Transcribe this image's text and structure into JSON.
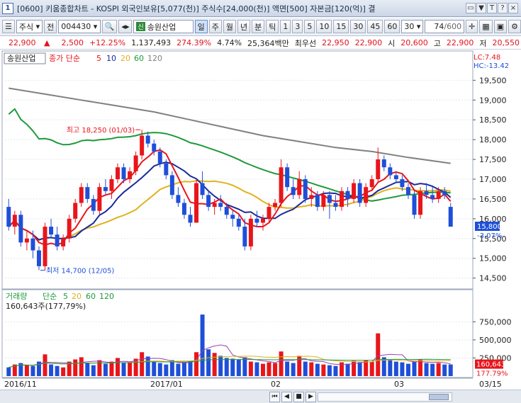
{
  "window": {
    "number": "1",
    "title": "[0600] 키움종합차트 - KOSPI 외국인보유[5,077(천)] 주식수[24,000(천)] 액면[500] 자본금[120(억)] 결",
    "buttons": [
      "▭",
      "▼",
      "T",
      "?",
      "×"
    ]
  },
  "toolbar": {
    "market": "주식",
    "jeon": "전",
    "code": "004430",
    "stock_badge": "신",
    "stock_name": "송원산업",
    "period_buttons": [
      "일",
      "주",
      "월",
      "년",
      "분",
      "틱"
    ],
    "active_period": "일",
    "interval_buttons": [
      "1",
      "3",
      "5",
      "10",
      "15",
      "30",
      "45",
      "60"
    ],
    "interval_value": "30",
    "count": "74",
    "count_total": "/600"
  },
  "infobar": {
    "price": "22,900",
    "change_arrow": "▲",
    "change": "2,500",
    "change_pct": "+12.25%",
    "volume": "1,137,493",
    "vol_ratio": "274.39%",
    "turnover": "4.74%",
    "amount": "25,364백만",
    "best_label": "최우선",
    "best_ask": "22,950",
    "best_bid": "22,900",
    "open_label": "시",
    "open": "20,600",
    "high_label": "고",
    "high": "22,900",
    "low_label": "저",
    "low": "20,550"
  },
  "price_panel": {
    "stock_tag": "송원산업",
    "legend": [
      "종가 단순",
      "5",
      "10",
      "20",
      "60",
      "120"
    ],
    "lc": "LC:7.48",
    "hc": "HC:-13.42",
    "max_label": "최고 18,250 (01/03)",
    "min_label": "최저 14,700 (12/05)",
    "last_label": "15,800",
    "last_pct": "-3.07%"
  },
  "volume_panel": {
    "legend": [
      "거래량",
      "단순",
      "5",
      "20",
      "60",
      "120"
    ],
    "info": "160,643주(177,79%)",
    "last_label": "160,643",
    "last_pct": "177.79%"
  },
  "date_axis": [
    "2016/11",
    "2017/01",
    "02",
    "03",
    "03/15"
  ],
  "colors": {
    "up": "#e8151b",
    "down": "#1f4fd8",
    "ma5": "#e8151b",
    "ma10": "#1a2a9a",
    "ma20": "#e0b21e",
    "ma60": "#1f9a3a",
    "ma120": "#808080"
  },
  "chart_data": {
    "type": "candlestick",
    "price_axis_ticks": [
      14500,
      15000,
      15500,
      16000,
      16500,
      17000,
      17500,
      18000,
      18500,
      19000,
      19500
    ],
    "price_axis_labels": [
      "14,500",
      "15,000",
      "15,500",
      "16,000",
      "16,500",
      "17,000",
      "17,500",
      "18,000",
      "18,500",
      "19,000",
      "19,500"
    ],
    "ylim": [
      14350,
      19900
    ],
    "volume_axis_ticks": [
      250000,
      500000,
      750000
    ],
    "volume_axis_labels": [
      "250,000",
      "500,000",
      "750,000"
    ],
    "volume_ylim": [
      0,
      900000
    ],
    "candles": [
      [
        16300,
        16500,
        15700,
        15800,
        120000
      ],
      [
        15800,
        16200,
        15600,
        16100,
        160000
      ],
      [
        16100,
        16200,
        15300,
        15400,
        180000
      ],
      [
        15400,
        15700,
        15200,
        15500,
        150000
      ],
      [
        15500,
        15700,
        15000,
        15200,
        140000
      ],
      [
        15200,
        15300,
        14700,
        14800,
        200000
      ],
      [
        14800,
        15900,
        14700,
        15800,
        300000
      ],
      [
        15800,
        16000,
        15500,
        15600,
        160000
      ],
      [
        15600,
        15800,
        15200,
        15300,
        140000
      ],
      [
        15300,
        15600,
        15200,
        15500,
        120000
      ],
      [
        15500,
        16100,
        15400,
        16000,
        200000
      ],
      [
        16000,
        16500,
        15900,
        16400,
        230000
      ],
      [
        16400,
        16900,
        16300,
        16800,
        260000
      ],
      [
        16800,
        16900,
        16400,
        16500,
        180000
      ],
      [
        16500,
        16600,
        16100,
        16200,
        150000
      ],
      [
        16200,
        16900,
        16100,
        16800,
        220000
      ],
      [
        16800,
        17000,
        16600,
        16700,
        170000
      ],
      [
        16700,
        17100,
        16500,
        17000,
        200000
      ],
      [
        17000,
        17400,
        16900,
        17300,
        250000
      ],
      [
        17300,
        17400,
        16900,
        17000,
        180000
      ],
      [
        17000,
        17300,
        16900,
        17200,
        190000
      ],
      [
        17200,
        17700,
        17100,
        17600,
        240000
      ],
      [
        17600,
        18250,
        17500,
        18100,
        330000
      ],
      [
        18100,
        18200,
        17800,
        17900,
        270000
      ],
      [
        17900,
        18000,
        17600,
        17700,
        200000
      ],
      [
        17700,
        17800,
        17300,
        17400,
        180000
      ],
      [
        17400,
        17500,
        17000,
        17100,
        160000
      ],
      [
        17100,
        17200,
        16500,
        16600,
        220000
      ],
      [
        16600,
        16800,
        16300,
        16400,
        170000
      ],
      [
        16400,
        16500,
        16000,
        16100,
        190000
      ],
      [
        16100,
        16300,
        15800,
        15900,
        210000
      ],
      [
        15900,
        17000,
        15900,
        16900,
        330000
      ],
      [
        16900,
        17200,
        16500,
        16600,
        850000
      ],
      [
        16600,
        16700,
        16200,
        16300,
        370000
      ],
      [
        16300,
        16500,
        16100,
        16400,
        320000
      ],
      [
        16400,
        16600,
        16200,
        16300,
        280000
      ],
      [
        16300,
        16400,
        16000,
        16100,
        250000
      ],
      [
        16100,
        16200,
        15800,
        16000,
        240000
      ],
      [
        16000,
        16100,
        15700,
        15800,
        230000
      ],
      [
        15800,
        16000,
        15200,
        15300,
        260000
      ],
      [
        15300,
        16100,
        15200,
        16000,
        200000
      ],
      [
        16000,
        16200,
        15800,
        15900,
        190000
      ],
      [
        15900,
        16100,
        15700,
        16000,
        170000
      ],
      [
        16000,
        16400,
        15900,
        16300,
        190000
      ],
      [
        16300,
        16500,
        16200,
        16400,
        180000
      ],
      [
        16400,
        17500,
        16300,
        17300,
        340000
      ],
      [
        17300,
        17400,
        16700,
        16800,
        200000
      ],
      [
        16800,
        17000,
        16500,
        16600,
        180000
      ],
      [
        16600,
        17200,
        16500,
        17000,
        280000
      ],
      [
        17000,
        17100,
        16400,
        16500,
        200000
      ],
      [
        16500,
        16800,
        16300,
        16600,
        190000
      ],
      [
        16600,
        16700,
        16200,
        16300,
        170000
      ],
      [
        16300,
        16700,
        16200,
        16600,
        160000
      ],
      [
        16600,
        16700,
        16000,
        16400,
        150000
      ],
      [
        16400,
        16600,
        16200,
        16300,
        140000
      ],
      [
        16300,
        16800,
        16200,
        16700,
        190000
      ],
      [
        16700,
        16800,
        16300,
        16500,
        170000
      ],
      [
        16500,
        17000,
        16400,
        16900,
        210000
      ],
      [
        16900,
        17000,
        16300,
        16400,
        190000
      ],
      [
        16400,
        16900,
        16300,
        16800,
        220000
      ],
      [
        16800,
        17100,
        16700,
        17000,
        200000
      ],
      [
        17000,
        17800,
        16900,
        17500,
        590000
      ],
      [
        17500,
        17600,
        17200,
        17300,
        260000
      ],
      [
        17300,
        17400,
        17000,
        17100,
        230000
      ],
      [
        17100,
        17200,
        16900,
        17000,
        200000
      ],
      [
        17000,
        17100,
        16700,
        16800,
        190000
      ],
      [
        16800,
        16900,
        16500,
        16600,
        170000
      ],
      [
        16600,
        16700,
        16000,
        16100,
        200000
      ],
      [
        16100,
        16800,
        16000,
        16700,
        230000
      ],
      [
        16700,
        16900,
        16500,
        16600,
        180000
      ],
      [
        16600,
        16800,
        16400,
        16500,
        170000
      ],
      [
        16500,
        16800,
        16400,
        16700,
        180000
      ],
      [
        16700,
        16800,
        16500,
        16600,
        160000
      ],
      [
        16300,
        16400,
        15800,
        15800,
        160643
      ]
    ],
    "ma120": [
      [
        0,
        19300
      ],
      [
        6,
        19150
      ],
      [
        12,
        19000
      ],
      [
        18,
        18850
      ],
      [
        24,
        18700
      ],
      [
        30,
        18500
      ],
      [
        36,
        18300
      ],
      [
        42,
        18100
      ],
      [
        48,
        17950
      ],
      [
        54,
        17800
      ],
      [
        60,
        17700
      ],
      [
        66,
        17550
      ],
      [
        73,
        17400
      ]
    ]
  }
}
